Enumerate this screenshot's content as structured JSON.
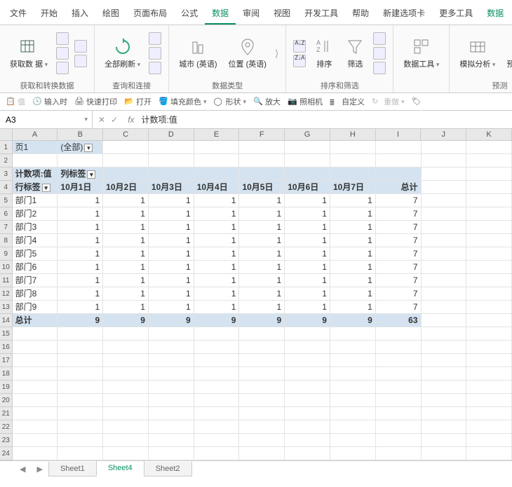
{
  "menu": {
    "items": [
      "文件",
      "开始",
      "插入",
      "绘图",
      "页面布局",
      "公式",
      "数据",
      "审阅",
      "视图",
      "开发工具",
      "帮助",
      "新建选项卡",
      "更多工具",
      "数据"
    ],
    "active": 6
  },
  "ribbon": {
    "g1": {
      "title": "获取和转换数据",
      "btn": "获取数\n据"
    },
    "g2": {
      "title": "查询和连接",
      "btn": "全部刷新"
    },
    "g3": {
      "title": "数据类型",
      "btn1": "城市 (英语)",
      "btn2": "位置 (英语)"
    },
    "g4": {
      "title": "排序和筛选",
      "btn1": "排序",
      "btn2": "筛选"
    },
    "g5": {
      "btn": "数据工具"
    },
    "g6": {
      "title": "预测",
      "btn1": "模拟分析",
      "btn2": "预测\n工作"
    }
  },
  "quickbar": [
    "值",
    "输入时",
    "快速打印",
    "打开",
    "填充颜色",
    "形状",
    "放大",
    "照相机",
    "自定义",
    "重做"
  ],
  "namebox": "A3",
  "formula": "计数项:值",
  "columns": [
    "A",
    "B",
    "C",
    "D",
    "E",
    "F",
    "G",
    "H",
    "I",
    "J",
    "K"
  ],
  "pivot": {
    "page_label": "页1",
    "page_value": "(全部)",
    "data_label": "计数项:值",
    "col_label": "列标签",
    "row_label": "行标签",
    "col_headers": [
      "10月1日",
      "10月2日",
      "10月3日",
      "10月4日",
      "10月5日",
      "10月6日",
      "10月7日",
      "总计"
    ],
    "rows": [
      {
        "label": "部门1",
        "vals": [
          1,
          1,
          1,
          1,
          1,
          1,
          1,
          7
        ]
      },
      {
        "label": "部门2",
        "vals": [
          1,
          1,
          1,
          1,
          1,
          1,
          1,
          7
        ]
      },
      {
        "label": "部门3",
        "vals": [
          1,
          1,
          1,
          1,
          1,
          1,
          1,
          7
        ]
      },
      {
        "label": "部门4",
        "vals": [
          1,
          1,
          1,
          1,
          1,
          1,
          1,
          7
        ]
      },
      {
        "label": "部门5",
        "vals": [
          1,
          1,
          1,
          1,
          1,
          1,
          1,
          7
        ]
      },
      {
        "label": "部门6",
        "vals": [
          1,
          1,
          1,
          1,
          1,
          1,
          1,
          7
        ]
      },
      {
        "label": "部门7",
        "vals": [
          1,
          1,
          1,
          1,
          1,
          1,
          1,
          7
        ]
      },
      {
        "label": "部门8",
        "vals": [
          1,
          1,
          1,
          1,
          1,
          1,
          1,
          7
        ]
      },
      {
        "label": "部门9",
        "vals": [
          1,
          1,
          1,
          1,
          1,
          1,
          1,
          7
        ]
      }
    ],
    "total_label": "总计",
    "totals": [
      9,
      9,
      9,
      9,
      9,
      9,
      9,
      63
    ]
  },
  "sheets": [
    "Sheet1",
    "Sheet4",
    "Sheet2"
  ],
  "active_sheet": 1
}
